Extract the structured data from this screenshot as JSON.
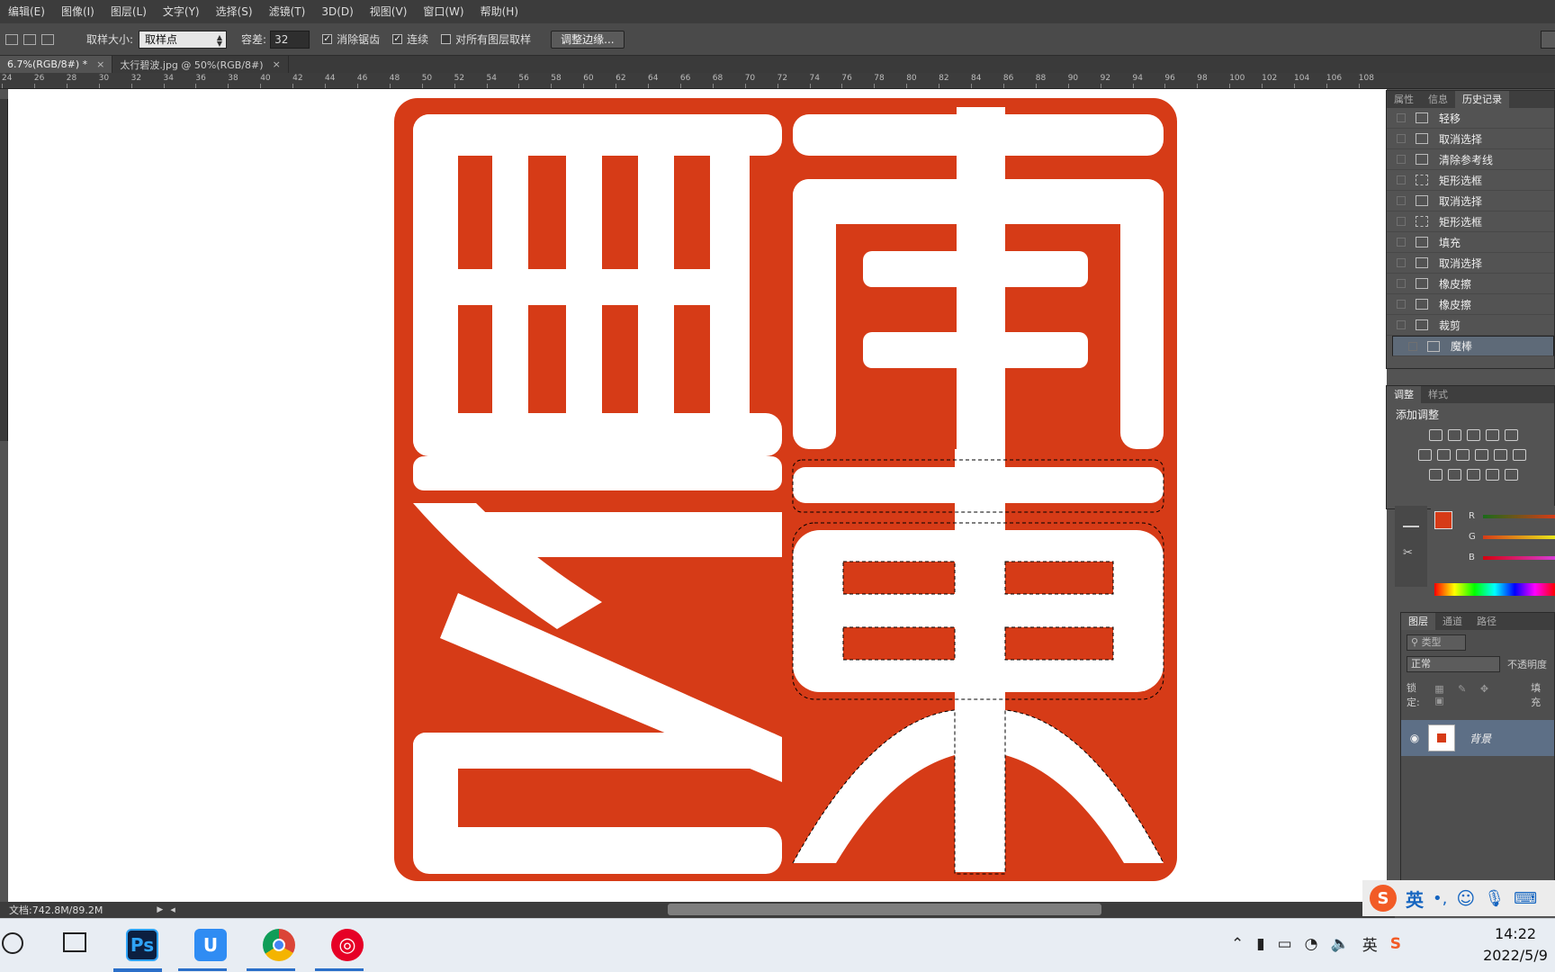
{
  "menu": [
    "编辑(E)",
    "图像(I)",
    "图层(L)",
    "文字(Y)",
    "选择(S)",
    "滤镜(T)",
    "3D(D)",
    "视图(V)",
    "窗口(W)",
    "帮助(H)"
  ],
  "options": {
    "sample_size_label": "取样大小:",
    "sample_size_value": "取样点",
    "tolerance_label": "容差:",
    "tolerance_value": "32",
    "antialias_label": "消除锯齿",
    "contiguous_label": "连续",
    "sample_all_label": "对所有图层取样",
    "refine_edge_label": "调整边缘..."
  },
  "tabs": [
    {
      "label": "6.7%(RGB/8#) *",
      "active": true
    },
    {
      "label": "太行碧波.jpg @ 50%(RGB/8#)",
      "active": false
    }
  ],
  "ruler_labels": [
    "24",
    "26",
    "28",
    "30",
    "32",
    "34",
    "36",
    "38",
    "40",
    "42",
    "44",
    "46",
    "48",
    "50",
    "52",
    "54",
    "56",
    "58",
    "60",
    "62",
    "64",
    "66",
    "68",
    "70",
    "72",
    "74",
    "76",
    "78",
    "80",
    "82",
    "84",
    "86",
    "88",
    "90",
    "92",
    "94",
    "96",
    "98",
    "100",
    "102",
    "104",
    "106",
    "108"
  ],
  "panels": {
    "top_tabs": [
      "属性",
      "信息",
      "历史记录"
    ],
    "history": [
      {
        "label": "轻移",
        "icon": "doc-icon"
      },
      {
        "label": "取消选择",
        "icon": "doc-icon"
      },
      {
        "label": "清除参考线",
        "icon": "doc-icon"
      },
      {
        "label": "矩形选框",
        "icon": "marquee-icon"
      },
      {
        "label": "取消选择",
        "icon": "doc-icon"
      },
      {
        "label": "矩形选框",
        "icon": "marquee-icon"
      },
      {
        "label": "填充",
        "icon": "fill-icon"
      },
      {
        "label": "取消选择",
        "icon": "doc-icon"
      },
      {
        "label": "橡皮擦",
        "icon": "eraser-icon"
      },
      {
        "label": "橡皮擦",
        "icon": "eraser-icon"
      },
      {
        "label": "裁剪",
        "icon": "crop-icon"
      },
      {
        "label": "魔棒",
        "icon": "magic-wand-icon",
        "selected": true
      }
    ],
    "adjust_tabs": [
      "调整",
      "样式"
    ],
    "adjust_title": "添加调整",
    "color_channels": [
      "R",
      "G",
      "B"
    ],
    "foreground_color": "#d63b17",
    "layers_tabs": [
      "图层",
      "通道",
      "路径"
    ],
    "layer_filter": "类型",
    "blend_mode": "正常",
    "opacity_label": "不透明度",
    "lock_label": "锁定:",
    "fill_label": "填充",
    "layer_name": "背景"
  },
  "seal": {
    "color": "#d63b17",
    "characters": [
      "南",
      "東",
      "樂",
      "己"
    ]
  },
  "status": {
    "doc": "文档:742.8M/89.2M"
  },
  "taskbar": {
    "ime_label": "英",
    "time": "14:22",
    "date": "2022/5/9"
  }
}
